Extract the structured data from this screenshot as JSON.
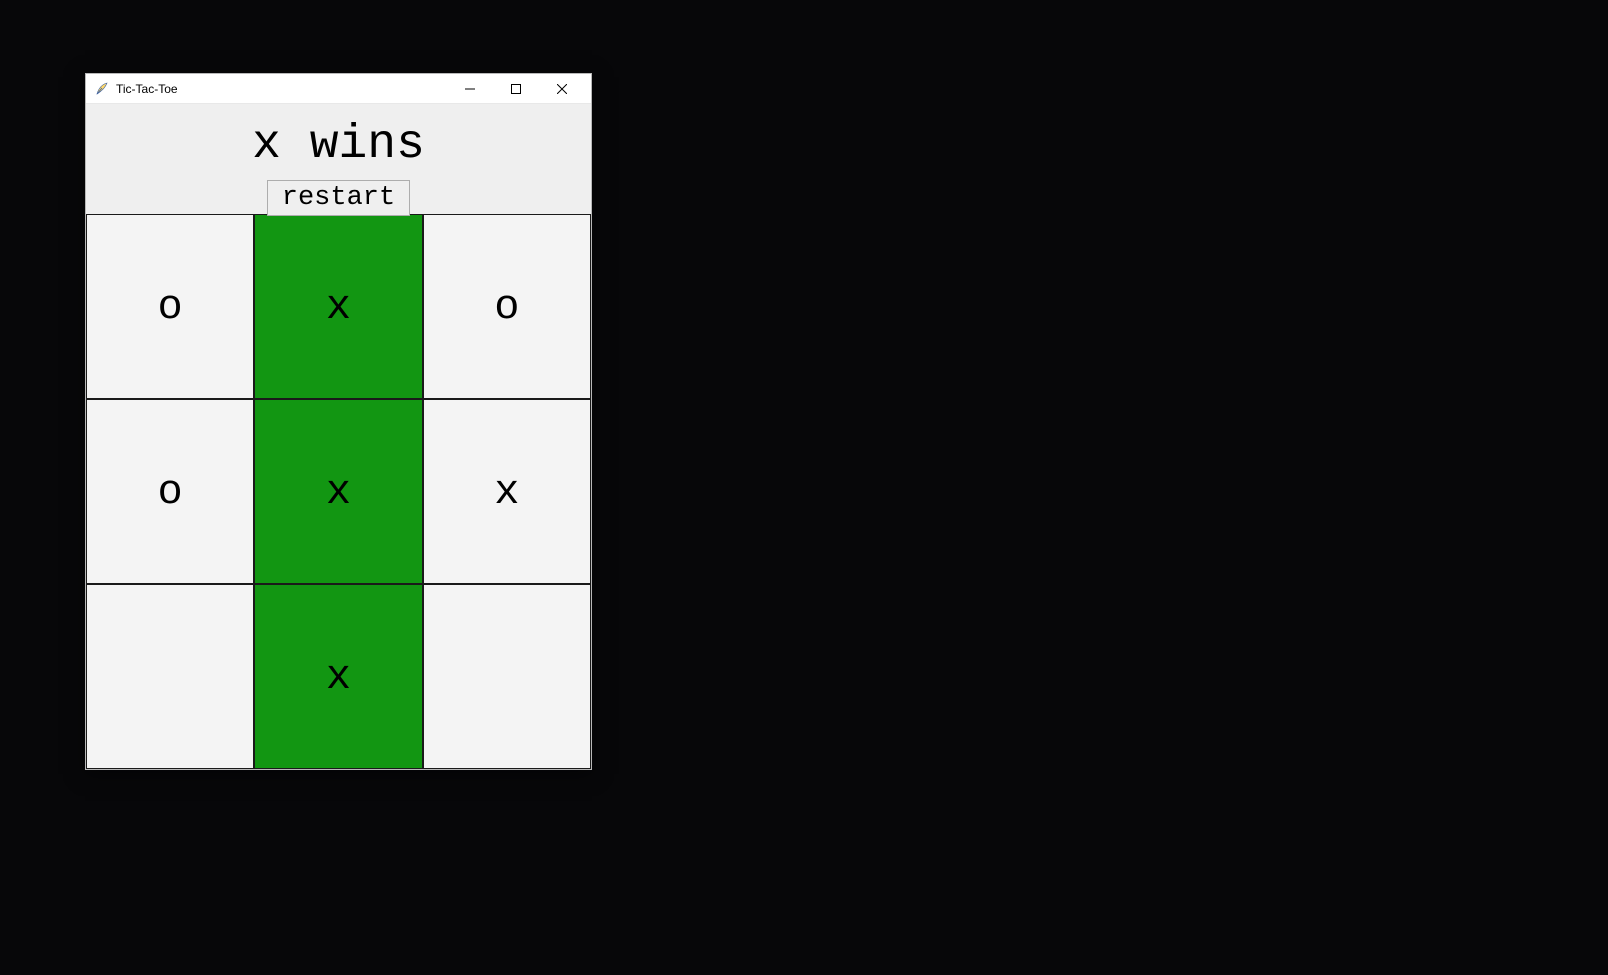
{
  "window": {
    "title": "Tic-Tac-Toe"
  },
  "header": {
    "status_label": "x wins",
    "restart_label": "restart"
  },
  "board": {
    "cells": [
      {
        "v": "o",
        "win": false
      },
      {
        "v": "x",
        "win": true
      },
      {
        "v": "o",
        "win": false
      },
      {
        "v": "o",
        "win": false
      },
      {
        "v": "x",
        "win": true
      },
      {
        "v": "x",
        "win": false
      },
      {
        "v": "",
        "win": false
      },
      {
        "v": "x",
        "win": true
      },
      {
        "v": "",
        "win": false
      }
    ]
  },
  "colors": {
    "win_highlight": "#129612",
    "cell_bg": "#f4f4f4",
    "window_bg": "#efefef"
  }
}
